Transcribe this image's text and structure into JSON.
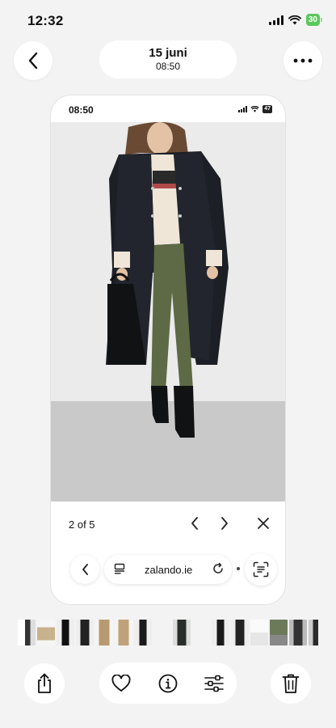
{
  "status_bar": {
    "time": "12:32",
    "battery": "30"
  },
  "header": {
    "title": "15 juni",
    "subtitle": "08:50"
  },
  "screenshot": {
    "status_bar": {
      "time": "08:50",
      "battery": "47"
    },
    "pager": {
      "text": "2 of 5"
    },
    "url_bar": {
      "domain": "zalando.ie"
    }
  },
  "icons": {
    "back": "chevron-left-icon",
    "more": "ellipsis-icon",
    "share": "share-icon",
    "favorite": "heart-icon",
    "info": "info-icon",
    "adjust": "sliders-icon",
    "delete": "trash-icon"
  },
  "colors": {
    "battery_green": "#5ac85a",
    "background": "#f3f3f3"
  }
}
